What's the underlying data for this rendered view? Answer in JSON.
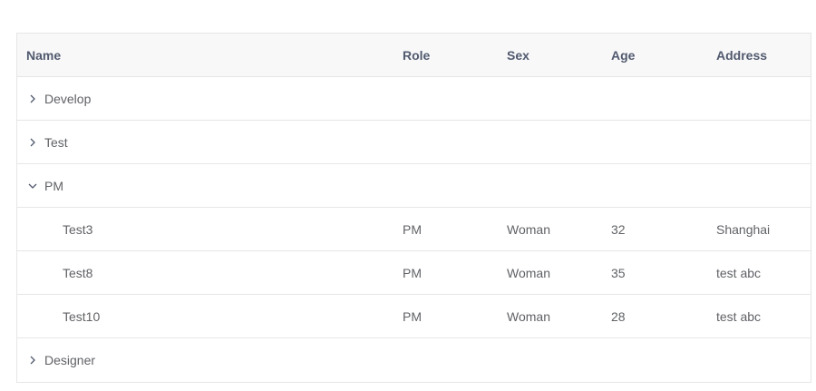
{
  "columns": {
    "name": "Name",
    "role": "Role",
    "sex": "Sex",
    "age": "Age",
    "address": "Address"
  },
  "groups": [
    {
      "label": "Develop",
      "expanded": false
    },
    {
      "label": "Test",
      "expanded": false
    },
    {
      "label": "PM",
      "expanded": true,
      "children": [
        {
          "name": "Test3",
          "role": "PM",
          "sex": "Woman",
          "age": "32",
          "address": "Shanghai"
        },
        {
          "name": "Test8",
          "role": "PM",
          "sex": "Woman",
          "age": "35",
          "address": "test abc"
        },
        {
          "name": "Test10",
          "role": "PM",
          "sex": "Woman",
          "age": "28",
          "address": "test abc"
        }
      ]
    },
    {
      "label": "Designer",
      "expanded": false
    }
  ],
  "icons": {
    "collapsed": "chevron-right-icon",
    "expanded": "chevron-down-icon"
  },
  "colors": {
    "border": "#e6e6e6",
    "header_bg": "#f8f8f9",
    "text": "#606266"
  }
}
